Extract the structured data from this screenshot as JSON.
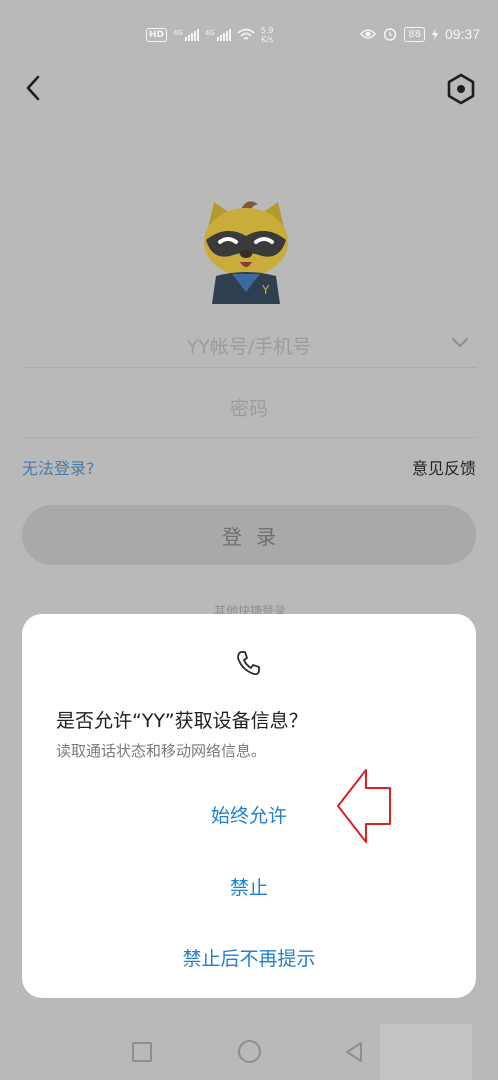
{
  "status_bar": {
    "hd_badge": "HD",
    "sim1_label": "4G",
    "sim2_label": "4G",
    "speed_top": "5.9",
    "speed_bottom": "K/s",
    "battery": "88",
    "time": "09:37"
  },
  "login": {
    "account_placeholder": "YY帐号/手机号",
    "password_placeholder": "密码",
    "cant_login_link": "无法登录?",
    "feedback_link": "意见反馈",
    "login_button": "登录",
    "hidden_behind_dialog": "其他快捷登录"
  },
  "dialog": {
    "title": "是否允许“YY”获取设备信息？",
    "subtitle": "读取通话状态和移动网络信息。",
    "allow_always": "始终允许",
    "deny": "禁止",
    "deny_no_ask": "禁止后不再提示",
    "accent_color": "#1f7fd0",
    "annotation_arrow_color": "#e02020"
  },
  "icons": {
    "back": "chevron-left-icon",
    "settings": "hexagon-gear-icon",
    "phone": "phone-icon",
    "dropdown": "chevron-down-icon",
    "mascot": "yy-raccoon-mascot"
  }
}
